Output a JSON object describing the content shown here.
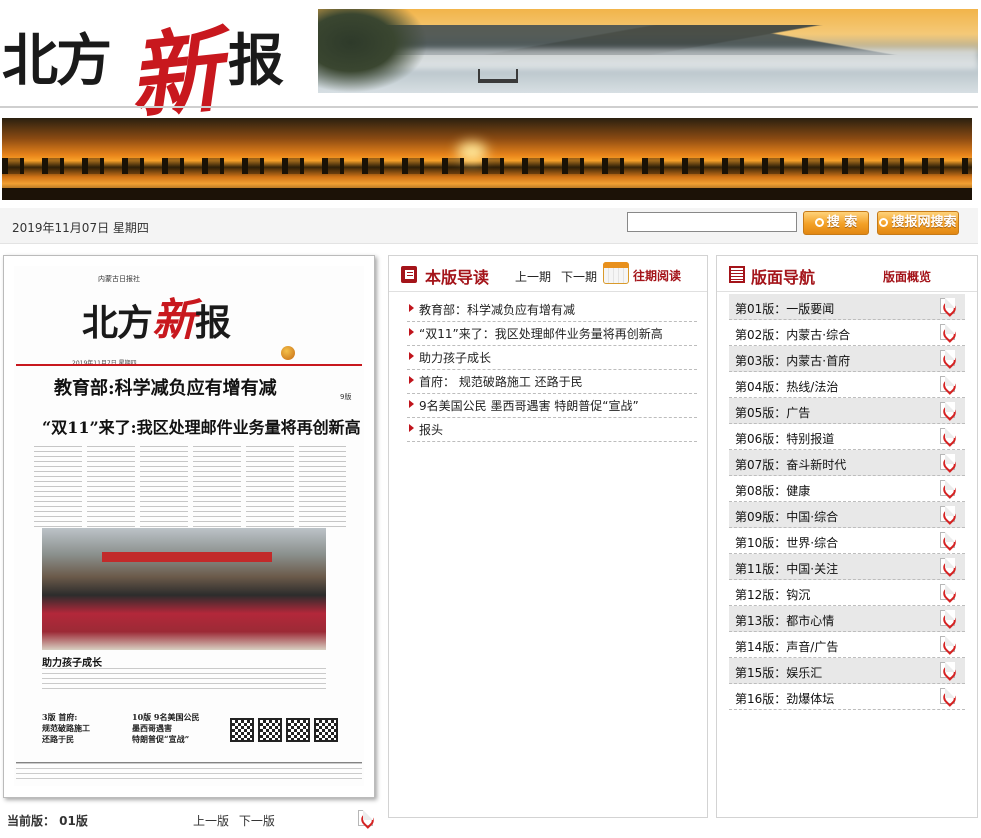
{
  "header": {
    "logo_text": "北方新报",
    "date": "2019年11月07日 星期四",
    "search_placeholder": "",
    "search_button": "搜 索",
    "net_search_button": "搜报网搜索"
  },
  "preview": {
    "paper": {
      "masthead_sub": "内蒙古日报社",
      "masthead": [
        "北方",
        "新",
        "报"
      ],
      "meta": "2019年11月7日 星期四",
      "headline_1": "教育部:科学减负应有增有减",
      "headline_2": "“双11”来了:我区处理邮件业务量将再创新高",
      "page_ref": "9版",
      "photo_caption": "助力孩子成长",
      "teaser_left": [
        "3版 首府:",
        "规范破路施工",
        "还路于民"
      ],
      "teaser_right": [
        "10版 9名美国公民",
        "墨西哥遇害",
        "特朗普促“宣战”"
      ]
    },
    "current_label": "当前版： 01版",
    "prev_page": "上一版",
    "next_page": "下一版"
  },
  "guide": {
    "title": "本版导读",
    "prev_issue": "上一期",
    "next_issue": "下一期",
    "past_reading": "往期阅读",
    "items": [
      "教育部：科学减负应有增有减",
      "“双11”来了：我区处理邮件业务量将再创新高",
      "助力孩子成长",
      "首府： 规范破路施工 还路于民",
      "9名美国公民 墨西哥遇害 特朗普促“宣战”",
      "报头"
    ]
  },
  "nav": {
    "title": "版面导航",
    "overview": "版面概览",
    "pages": [
      "第01版：一版要闻",
      "第02版：内蒙古·综合",
      "第03版：内蒙古·首府",
      "第04版：热线/法治",
      "第05版：广告",
      "第06版：特别报道",
      "第07版：奋斗新时代",
      "第08版：健康",
      "第09版：中国·综合",
      "第10版：世界·综合",
      "第11版：中国·关注",
      "第12版：钩沉",
      "第13版：都市心情",
      "第14版：声音/广告",
      "第15版：娱乐汇",
      "第16版：劲爆体坛"
    ]
  },
  "colors": {
    "accent": "#a4141a",
    "logo_red": "#c8181e",
    "button_orange": "#f3a026"
  }
}
